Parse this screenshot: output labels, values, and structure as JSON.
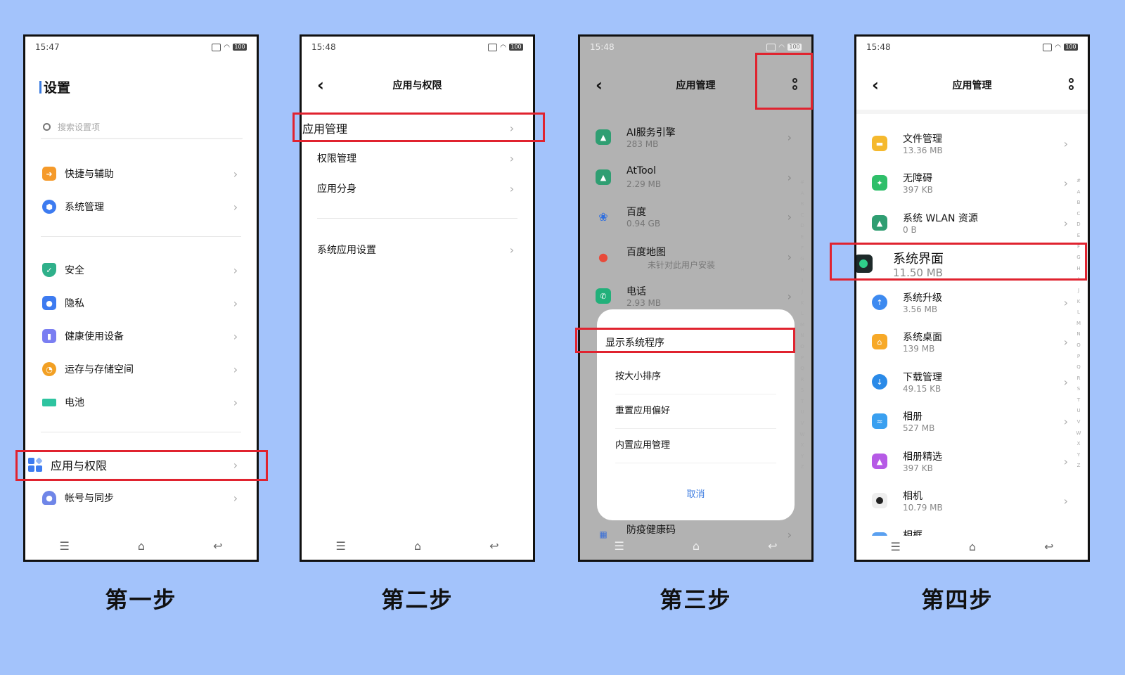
{
  "steps": [
    {
      "caption": "第一步",
      "status": {
        "time": "15:47",
        "battery": "100"
      },
      "title": "设置",
      "search_placeholder": "搜索设置项",
      "items": [
        {
          "label": "快捷与辅助",
          "icon": "shortcut-icon",
          "color": "#f59a2a"
        },
        {
          "label": "系统管理",
          "icon": "system-hexagon-icon",
          "color": "#3d7bf0"
        },
        {
          "label": "安全",
          "icon": "shield-icon",
          "color": "#2fb08a"
        },
        {
          "label": "隐私",
          "icon": "lock-icon",
          "color": "#3d7bf0"
        },
        {
          "label": "健康使用设备",
          "icon": "health-icon",
          "color": "#7a7ef2"
        },
        {
          "label": "运存与存储空间",
          "icon": "storage-pie-icon",
          "color": "#f2a024"
        },
        {
          "label": "电池",
          "icon": "battery-icon",
          "color": "#2ec4a0"
        },
        {
          "label": "应用与权限",
          "icon": "apps-grid-icon",
          "color": "#3d7bf0"
        },
        {
          "label": "帐号与同步",
          "icon": "account-icon",
          "color": "#6f86e8"
        }
      ]
    },
    {
      "caption": "第二步",
      "status": {
        "time": "15:48",
        "battery": "100"
      },
      "title": "应用与权限",
      "items": [
        "应用管理",
        "权限管理",
        "应用分身",
        "系统应用设置"
      ]
    },
    {
      "caption": "第三步",
      "status": {
        "time": "15:48",
        "battery": "100"
      },
      "title": "应用管理",
      "apps": [
        {
          "name": "AI服务引擎",
          "size": "283 MB",
          "color": "#2f9e72"
        },
        {
          "name": "AtTool",
          "size": "2.29 MB",
          "color": "#2f9e72"
        },
        {
          "name": "百度",
          "size": "0.94 GB",
          "color": "#2f6fe0"
        },
        {
          "name": "百度地图",
          "size": "未针对此用户安装",
          "color": "#e84a3a"
        },
        {
          "name": "电话",
          "size": "2.93 MB",
          "color": "#22b07a"
        },
        {
          "name": "防疫健康码",
          "size": "",
          "color": "#3a6fd8"
        }
      ],
      "menu": [
        "显示系统程序",
        "按大小排序",
        "重置应用偏好",
        "内置应用管理"
      ],
      "cancel": "取消"
    },
    {
      "caption": "第四步",
      "status": {
        "time": "15:48",
        "battery": "100"
      },
      "title": "应用管理",
      "apps": [
        {
          "name": "文件管理",
          "size": "13.36 MB",
          "color": "#f5b92e"
        },
        {
          "name": "无障碍",
          "size": "397 KB",
          "color": "#2fbf6a"
        },
        {
          "name": "系统 WLAN 资源",
          "size": "0 B",
          "color": "#2f9e72"
        },
        {
          "name": "系统界面",
          "size": "11.50 MB",
          "color": "#1e2a2a"
        },
        {
          "name": "系统升级",
          "size": "3.56 MB",
          "color": "#3d8af0"
        },
        {
          "name": "系统桌面",
          "size": "139 MB",
          "color": "#f7a928"
        },
        {
          "name": "下载管理",
          "size": "49.15 KB",
          "color": "#2a8ae8"
        },
        {
          "name": "相册",
          "size": "527 MB",
          "color": "#3aa0f0"
        },
        {
          "name": "相册精选",
          "size": "397 KB",
          "color": "#b65ae6"
        },
        {
          "name": "相机",
          "size": "10.79 MB",
          "color": "#222222"
        },
        {
          "name": "相框",
          "size": "",
          "color": "#5aa0f0"
        }
      ]
    }
  ],
  "alphabet": [
    "#",
    "A",
    "B",
    "C",
    "D",
    "E",
    "F",
    "G",
    "H",
    "I",
    "J",
    "K",
    "L",
    "M",
    "N",
    "O",
    "P",
    "Q",
    "R",
    "S",
    "T",
    "U",
    "V",
    "W",
    "X",
    "Y",
    "Z"
  ],
  "colors": {
    "background": "#a3c3fb",
    "highlight": "#e0232f",
    "accent": "#3b7be0"
  }
}
